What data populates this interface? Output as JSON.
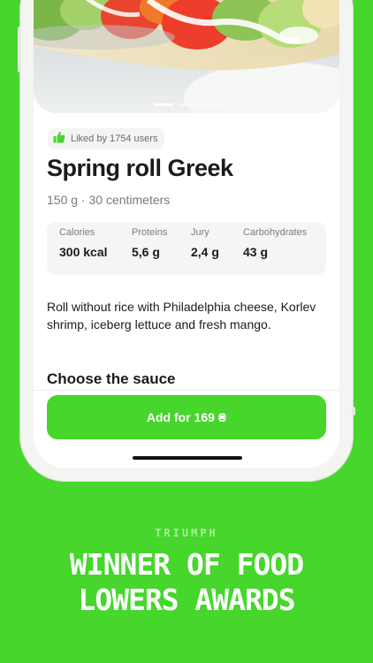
{
  "dish": {
    "likes_text": "Liked by 1754 users",
    "title": "Spring roll Greek",
    "subtitle": "150 g · 30 centimeters",
    "nutrition": [
      {
        "label": "Calories",
        "value": "300 kcal"
      },
      {
        "label": "Proteins",
        "value": "5,6 g"
      },
      {
        "label": "Jury",
        "value": "2,4 g"
      },
      {
        "label": "Carbohydrates",
        "value": "43 g"
      }
    ],
    "description": "Roll without rice with Philadelphia cheese, Korlev shrimp, iceberg lettuce and fresh mango.",
    "section_title": "Choose the sauce",
    "add_button_label": "Add for 169 ₴",
    "photo_pages": 3,
    "photo_active_page": 1
  },
  "promo": {
    "eyebrow": "TRIUMPH",
    "headline_line1": "WINNER OF FOOD",
    "headline_line2": "LOWERS AWARDS"
  },
  "colors": {
    "brand_green": "#46d62c",
    "text_dark": "#1b1b1b",
    "text_muted": "#7a7a7a"
  },
  "icons": {
    "likes": "thumbs-up-icon"
  }
}
